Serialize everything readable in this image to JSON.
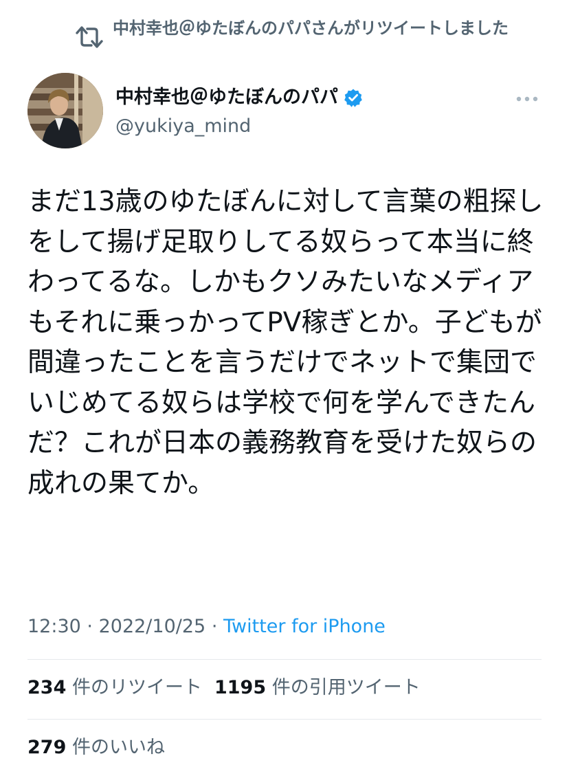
{
  "retweet": {
    "icon": "retweet-icon",
    "text": "中村幸也＠ゆたぼんのパパさんがリツイートしました"
  },
  "author": {
    "display_name": "中村幸也＠ゆたぼんのパパ",
    "verified": true,
    "handle": "@yukiya_mind"
  },
  "tweet": {
    "text": "まだ13歳のゆたぼんに対して言葉の粗探しをして揚げ足取りしてる奴らって本当に終わってるな。しかもクソみたいなメディアもそれに乗っかってPV稼ぎとか。子どもが間違ったことを言うだけでネットで集団でいじめてる奴らは学校で何を学んできたんだ？これが日本の義務教育を受けた奴らの成れの果てか。"
  },
  "meta": {
    "time": "12:30",
    "separator": "·",
    "date": "2022/10/25",
    "source": "Twitter for iPhone"
  },
  "stats": {
    "retweets": {
      "count": "234",
      "label": "件のリツイート"
    },
    "quotes": {
      "count": "1195",
      "label": "件の引用ツイート"
    },
    "likes": {
      "count": "279",
      "label": "件のいいね"
    }
  },
  "colors": {
    "text": "#0f1419",
    "secondary": "#536471",
    "link": "#1d9bf0",
    "divider": "#e6e9ec"
  }
}
